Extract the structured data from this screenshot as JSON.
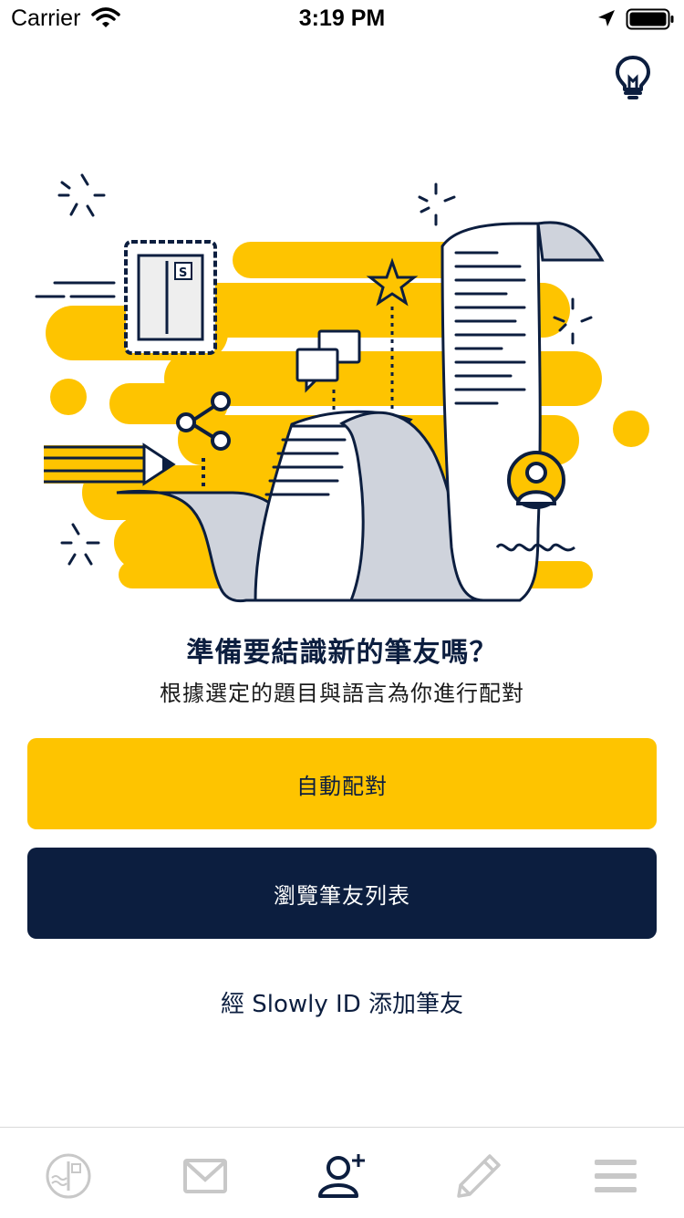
{
  "status_bar": {
    "carrier": "Carrier",
    "time": "3:19 PM"
  },
  "main": {
    "title": "準備要結識新的筆友嗎？",
    "subtitle": "根據選定的題目與語言為你進行配對",
    "auto_match_label": "自動配對",
    "browse_label": "瀏覽筆友列表",
    "add_by_id_label": "經 Slowly ID 添加筆友"
  },
  "colors": {
    "accent": "#fec400",
    "navy": "#0c1e3f",
    "tab_inactive": "#c8c8c8"
  },
  "tabs": [
    {
      "icon": "stamp-icon",
      "active": false
    },
    {
      "icon": "mail-icon",
      "active": false
    },
    {
      "icon": "add-friend-icon",
      "active": true
    },
    {
      "icon": "pencil-icon",
      "active": false
    },
    {
      "icon": "menu-icon",
      "active": false
    }
  ]
}
